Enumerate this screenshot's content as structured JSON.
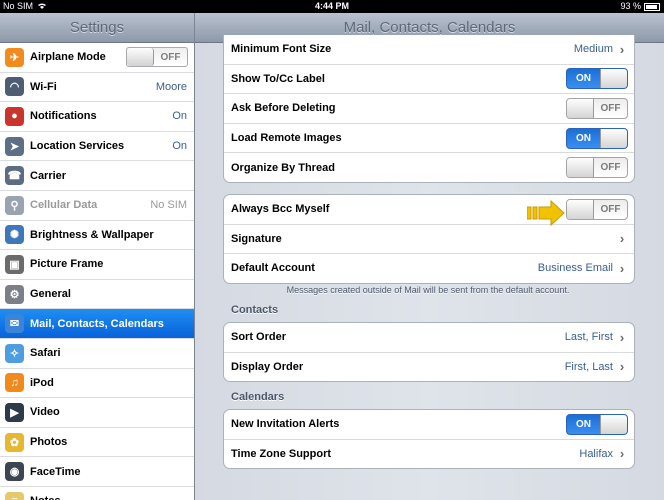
{
  "status_bar": {
    "carrier": "No SIM",
    "time": "4:44 PM",
    "battery": "93 %"
  },
  "left_pane": {
    "title": "Settings",
    "items": [
      {
        "label": "Airplane Mode",
        "icon": "airplane-icon",
        "toggle": "OFF",
        "color": "#f28a1d"
      },
      {
        "label": "Wi-Fi",
        "icon": "wifi-icon",
        "value": "Moore",
        "color": "#4f5d74"
      },
      {
        "label": "Notifications",
        "icon": "notifications-icon",
        "value": "On",
        "color": "#c9342c"
      },
      {
        "label": "Location Services",
        "icon": "location-icon",
        "value": "On",
        "color": "#5d6f86"
      },
      {
        "label": "Carrier",
        "icon": "carrier-icon",
        "value": "",
        "color": "#5c6c84"
      },
      {
        "label": "Cellular Data",
        "icon": "cellular-icon",
        "value": "No SIM",
        "color": "#9aa3b1",
        "disabled": true
      },
      {
        "label": "Brightness & Wallpaper",
        "icon": "brightness-icon",
        "value": "",
        "color": "#3f78b9"
      },
      {
        "label": "Picture Frame",
        "icon": "picture-frame-icon",
        "value": "",
        "color": "#6b6b6b"
      },
      {
        "label": "General",
        "icon": "gear-icon",
        "value": "",
        "color": "#7a7f88"
      },
      {
        "label": "Mail, Contacts, Calendars",
        "icon": "mail-icon",
        "value": "",
        "color": "#3c84d6",
        "selected": true
      },
      {
        "label": "Safari",
        "icon": "safari-icon",
        "value": "",
        "color": "#4d9de0"
      },
      {
        "label": "iPod",
        "icon": "ipod-icon",
        "value": "",
        "color": "#f08a1c"
      },
      {
        "label": "Video",
        "icon": "video-icon",
        "value": "",
        "color": "#2d3a4a"
      },
      {
        "label": "Photos",
        "icon": "photos-icon",
        "value": "",
        "color": "#e6b732"
      },
      {
        "label": "FaceTime",
        "icon": "facetime-icon",
        "value": "",
        "color": "#3d4552"
      },
      {
        "label": "Notes",
        "icon": "notes-icon",
        "value": "",
        "color": "#e7c96a"
      }
    ]
  },
  "right_pane": {
    "title": "Mail, Contacts, Calendars",
    "mail_group": [
      {
        "label": "Minimum Font Size",
        "value": "Medium",
        "type": "nav"
      },
      {
        "label": "Show To/Cc Label",
        "value": "ON",
        "type": "toggle"
      },
      {
        "label": "Ask Before Deleting",
        "value": "OFF",
        "type": "toggle"
      },
      {
        "label": "Load Remote Images",
        "value": "ON",
        "type": "toggle"
      },
      {
        "label": "Organize By Thread",
        "value": "OFF",
        "type": "toggle"
      }
    ],
    "compose_group": [
      {
        "label": "Always Bcc Myself",
        "value": "OFF",
        "type": "toggle"
      },
      {
        "label": "Signature",
        "value": "",
        "type": "nav"
      },
      {
        "label": "Default Account",
        "value": "Business Email",
        "type": "nav"
      }
    ],
    "default_account_note": "Messages created outside of Mail will be sent from the default account.",
    "contacts_header": "Contacts",
    "contacts_group": [
      {
        "label": "Sort Order",
        "value": "Last, First",
        "type": "nav"
      },
      {
        "label": "Display Order",
        "value": "First, Last",
        "type": "nav"
      }
    ],
    "calendars_header": "Calendars",
    "calendars_group": [
      {
        "label": "New Invitation Alerts",
        "value": "ON",
        "type": "toggle"
      },
      {
        "label": "Time Zone Support",
        "value": "Halifax",
        "type": "nav"
      }
    ]
  },
  "annotation": {
    "icon": "arrow-right-icon",
    "color": "#f2c200"
  }
}
